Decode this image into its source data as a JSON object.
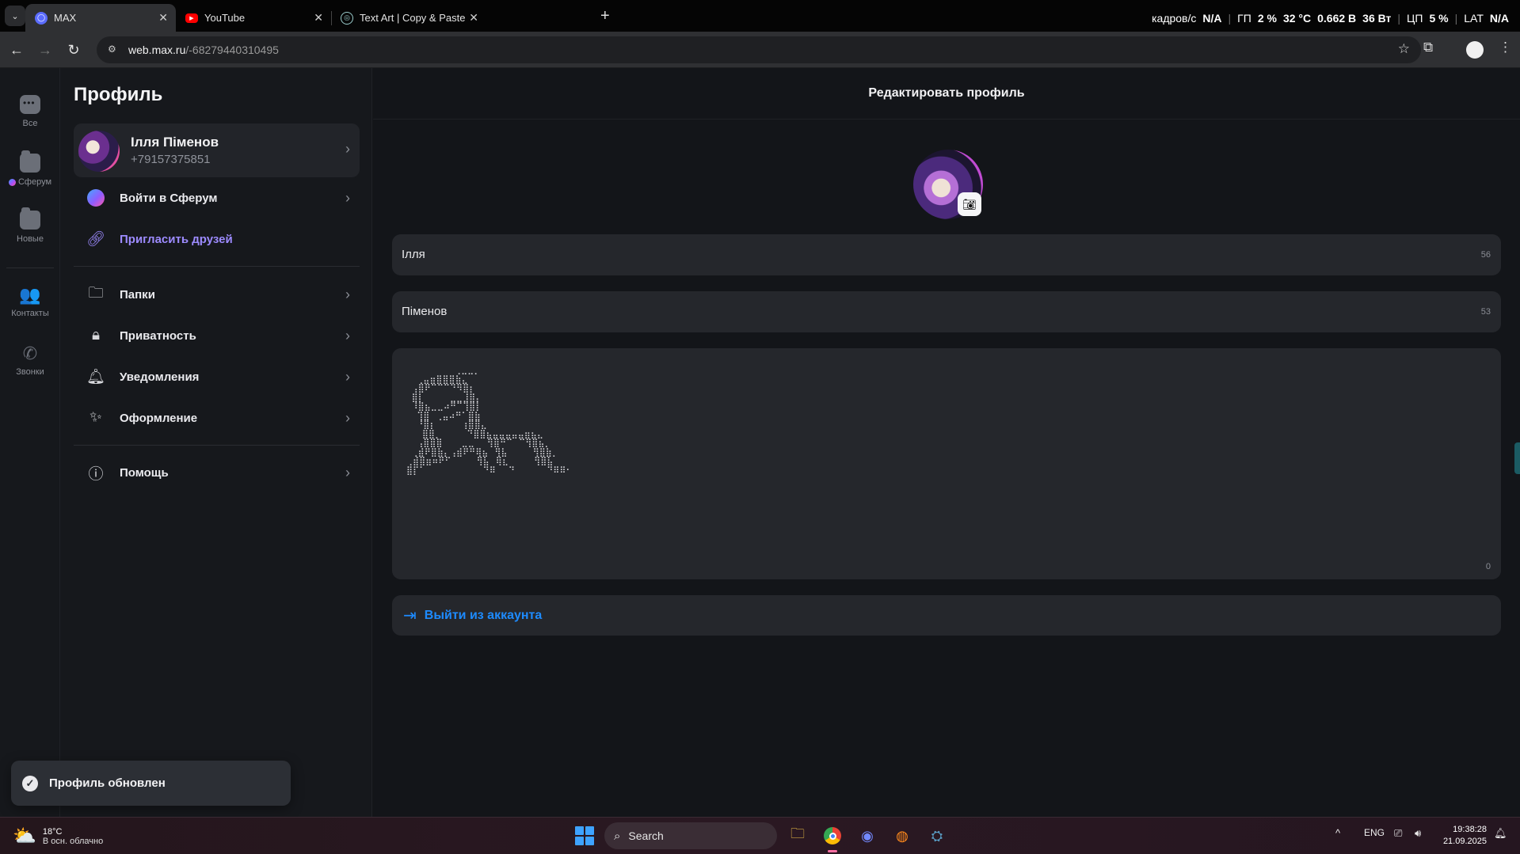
{
  "browser": {
    "tabs": [
      {
        "title": "MAX",
        "active": true
      },
      {
        "title": "YouTube",
        "active": false
      },
      {
        "title": "Text Art | Copy & Paste",
        "active": false
      }
    ],
    "url_host": "web.max.ru",
    "url_path": "/-68279440310495",
    "perf": {
      "fps_label": "кадров/с",
      "fps_value": "N/A",
      "gpu_label": "ГП",
      "gpu_load": "2 %",
      "gpu_temp": "32 °C",
      "gpu_volt": "0.662 В",
      "gpu_power": "36 Вт",
      "cpu_label": "ЦП",
      "cpu_load": "5 %",
      "lat_label": "LAT",
      "lat_value": "N/A"
    }
  },
  "rail": {
    "items": [
      {
        "label": "Все",
        "icon": "chat-icon"
      },
      {
        "label": "Сферум",
        "icon": "folder-icon"
      },
      {
        "label": "Новые",
        "icon": "folder-icon"
      },
      {
        "label": "Контакты",
        "icon": "contacts-icon"
      },
      {
        "label": "Звонки",
        "icon": "phone-icon"
      }
    ]
  },
  "sidebar": {
    "title": "Профиль",
    "profile": {
      "name": "Ілля Піменов",
      "phone": "+79157375851"
    },
    "sferum_login": "Войти в Сферум",
    "invite": "Пригласить друзей",
    "menu": [
      {
        "label": "Папки",
        "icon": "folder-icon"
      },
      {
        "label": "Приватность",
        "icon": "lock-icon"
      },
      {
        "label": "Уведомления",
        "icon": "bell-icon"
      },
      {
        "label": "Оформление",
        "icon": "magic-wand-icon"
      }
    ],
    "help": "Помощь"
  },
  "toast": {
    "text": "Профиль обновлен"
  },
  "main": {
    "title": "Редактировать профиль",
    "first_name": {
      "value": "Ілля",
      "remaining": "56"
    },
    "last_name": {
      "value": "Піменов",
      "remaining": "53"
    },
    "bio": {
      "art": "        ⠀⢀⣀⣀⡀\n  ⢀⣤⣶⣿⣿⣿⣷⣄\n ⢠⣿⠟⠉⠉⠉⠙⠻⣿⡆\n ⣿⡇⠀⠀⠀⠀⣀⣀⣸⣿⡄\n ⠸⣿⣦⣀⣀⠴⠛⠉⢹⣿⡇\n  ⢹⣿⠀⢀⣤⠴⠛⠁⣿⣷\n  ⠘⣿⡆⠀⠀⠀⠀⢰⣿⣿⣄\n   ⣿⣿⡀⠀⠀⠀⠀⠙⣿⣿⣦⣤⣤⣤⣤⣤⣶⣦⣄\n  ⢠⣿⣿⣿⠀⠀⠀⣀⣀⠀⠀⢻⣿⠛⠉⠀⠉⢻⣿⣦⡀\n ⢀⣾⠟⣿⣷⡄⢠⣾⠟⠛⢿⣦⠀⢻⣧⠀⠀⠀⠀⢻⣿⣷⡀\n⢀⣾⣿⣶⠶⠟⠋⠀⠀⠀⠀⢻⣧⠀⢿⣆⠀⠀⠀⠀⢻⣿⣧\n⣿⡏⠁⠀⠀⠀⠀⠀⠀⠀⠀⠀⠙⠿⠀⠀⠙⠀⠀⠀⠀⠀⠙⠿⠿⠂",
      "remaining": "0"
    },
    "logout": "Выйти из аккаунта"
  },
  "taskbar": {
    "weather_temp": "18°C",
    "weather_desc": "В осн. облачно",
    "search_placeholder": "Search",
    "lang": "ENG",
    "time": "19:38:28",
    "date": "21.09.2025"
  }
}
